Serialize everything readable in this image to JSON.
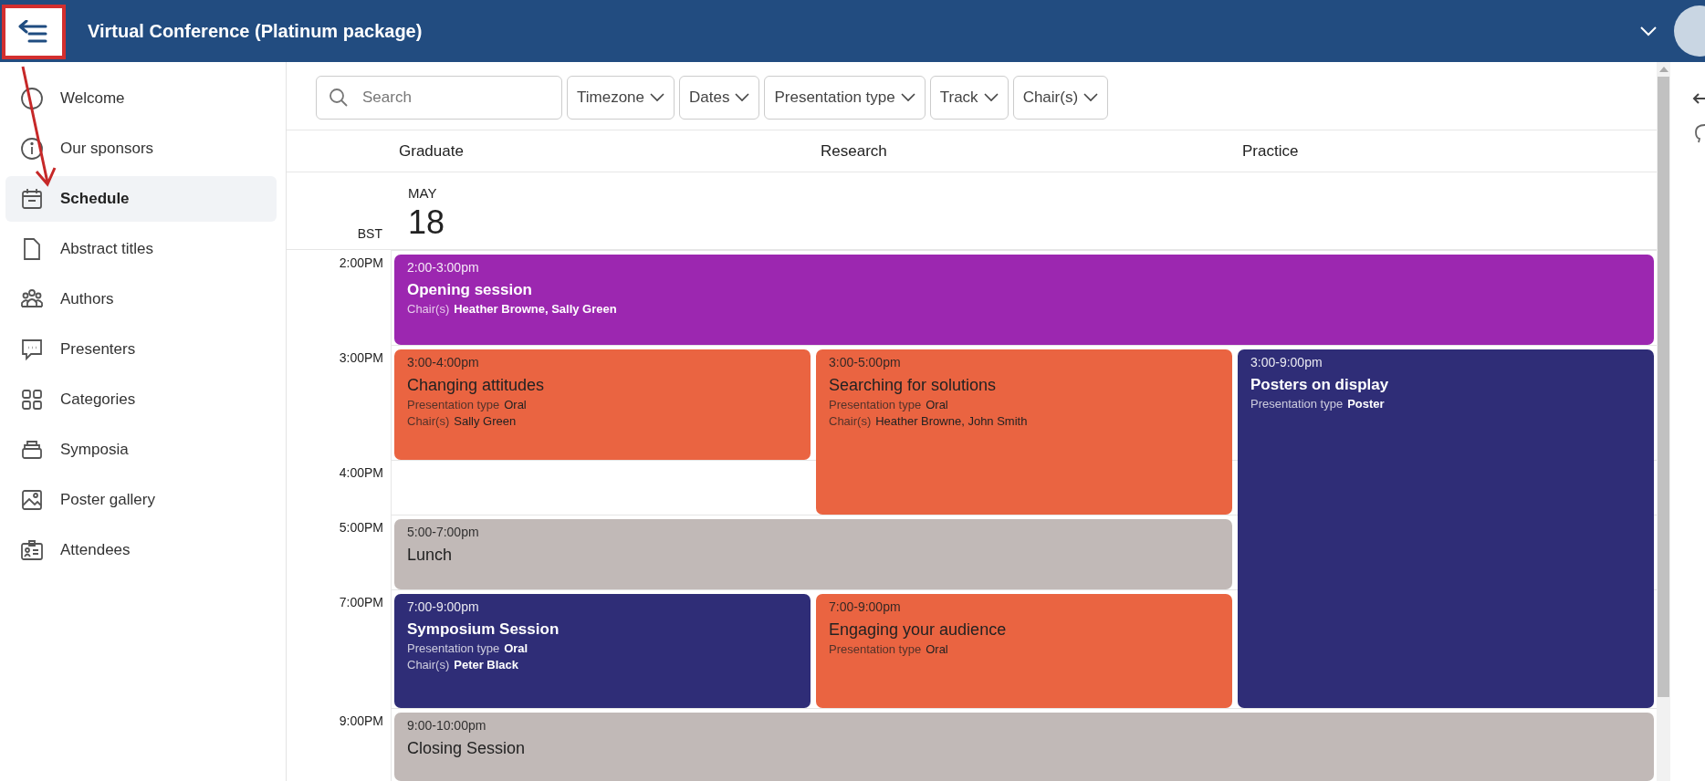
{
  "header": {
    "title": "Virtual Conference (Platinum package)"
  },
  "sidebar": {
    "items": [
      {
        "label": "Welcome",
        "selected": false
      },
      {
        "label": "Our sponsors",
        "selected": false
      },
      {
        "label": "Schedule",
        "selected": true
      },
      {
        "label": "Abstract titles",
        "selected": false
      },
      {
        "label": "Authors",
        "selected": false
      },
      {
        "label": "Presenters",
        "selected": false
      },
      {
        "label": "Categories",
        "selected": false
      },
      {
        "label": "Symposia",
        "selected": false
      },
      {
        "label": "Poster gallery",
        "selected": false
      },
      {
        "label": "Attendees",
        "selected": false
      }
    ]
  },
  "filters": {
    "search": {
      "placeholder": "Search"
    },
    "dropdowns": [
      "Timezone",
      "Dates",
      "Presentation type",
      "Track",
      "Chair(s)"
    ]
  },
  "tracks": [
    "Graduate",
    "Research",
    "Practice"
  ],
  "date": {
    "timezone": "BST",
    "month": "MAY",
    "day": "18"
  },
  "time_slots": [
    "2:00PM",
    "3:00PM",
    "4:00PM",
    "5:00PM",
    "7:00PM",
    "9:00PM"
  ],
  "events": [
    {
      "time": "2:00-3:00pm",
      "title": "Opening session",
      "color": "#9c27b0",
      "details": [
        {
          "label": "Chair(s)",
          "value": "Heather Browne, Sally Green"
        }
      ]
    },
    {
      "time": "3:00-4:00pm",
      "title": "Changing attitudes",
      "color": "#ea6441",
      "details": [
        {
          "label": "Presentation type",
          "value": "Oral"
        },
        {
          "label": "Chair(s)",
          "value": "Sally Green"
        }
      ]
    },
    {
      "time": "3:00-5:00pm",
      "title": "Searching for solutions",
      "color": "#ea6441",
      "details": [
        {
          "label": "Presentation type",
          "value": "Oral"
        },
        {
          "label": "Chair(s)",
          "value": "Heather Browne, John Smith"
        }
      ]
    },
    {
      "time": "3:00-9:00pm",
      "title": "Posters on display",
      "color": "#2f2d77",
      "details": [
        {
          "label": "Presentation type",
          "value": "Poster"
        }
      ]
    },
    {
      "time": "5:00-7:00pm",
      "title": "Lunch",
      "color": "#c1b9b7"
    },
    {
      "time": "7:00-9:00pm",
      "title": "Symposium Session",
      "color": "#2f2d77",
      "details": [
        {
          "label": "Presentation type",
          "value": "Oral"
        },
        {
          "label": "Chair(s)",
          "value": "Peter Black"
        }
      ]
    },
    {
      "time": "7:00-9:00pm",
      "title": "Engaging your audience",
      "color": "#ea6441",
      "details": [
        {
          "label": "Presentation type",
          "value": "Oral"
        }
      ]
    },
    {
      "time": "9:00-10:00pm",
      "title": "Closing Session",
      "color": "#c1b9b7"
    }
  ]
}
